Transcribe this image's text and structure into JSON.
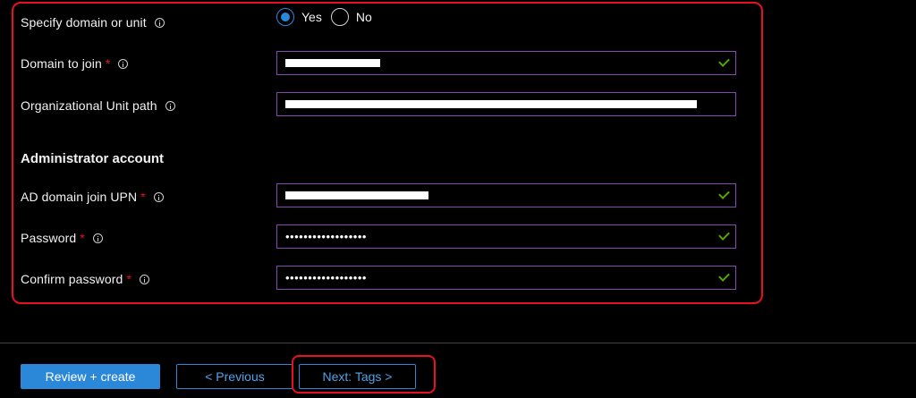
{
  "form": {
    "specify_domain": {
      "label": "Specify domain or unit",
      "options": [
        "Yes",
        "No"
      ],
      "selected": "Yes"
    },
    "domain_to_join": {
      "label": "Domain to join",
      "required_marker": "*"
    },
    "ou_path": {
      "label": "Organizational Unit path"
    },
    "admin_section_title": "Administrator account",
    "upn": {
      "label": "AD domain join UPN",
      "required_marker": "*"
    },
    "password": {
      "label": "Password",
      "required_marker": "*",
      "value": "••••••••••••••••••"
    },
    "confirm_password": {
      "label": "Confirm password",
      "required_marker": "*",
      "value": "••••••••••••••••••"
    }
  },
  "footer": {
    "review_create": "Review + create",
    "previous": "< Previous",
    "next": "Next: Tags >"
  },
  "colors": {
    "accent": "#2b88d8",
    "highlight_red": "#e81123",
    "valid_green": "#57a300",
    "field_border": "#8a46b5"
  },
  "icons": [
    "info-icon",
    "checkmark-icon"
  ]
}
